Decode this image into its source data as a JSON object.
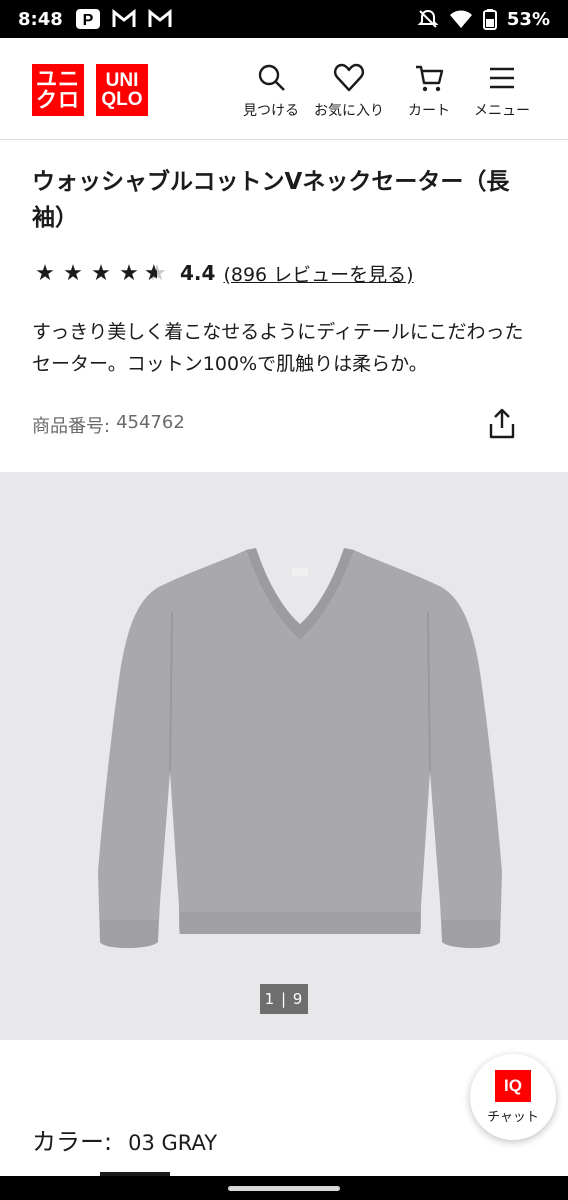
{
  "status_bar": {
    "time": "8:48",
    "battery": "53%",
    "icons": [
      "p-app-icon",
      "gmail-icon",
      "gmail-icon",
      "mute-icon",
      "wifi-icon",
      "battery-icon"
    ]
  },
  "header": {
    "logo_katakana_line1": "ユニ",
    "logo_katakana_line2": "クロ",
    "logo_latin_line1": "UNI",
    "logo_latin_line2": "QLO",
    "brand_color": "#ff0000",
    "nav": [
      {
        "label": "見つける",
        "icon": "search-icon"
      },
      {
        "label": "お気に入り",
        "icon": "heart-icon"
      },
      {
        "label": "カート",
        "icon": "cart-icon"
      },
      {
        "label": "メニュー",
        "icon": "menu-icon"
      }
    ]
  },
  "product": {
    "title": "ウォッシャブルコットンVネックセーター（長袖）",
    "rating": {
      "stars": 4.4,
      "value_label": "4.4",
      "review_link": "(896 レビューを見る)"
    },
    "description": "すっきり美しく着こなせるようにディテールにこだわったセーター。コットン100%で肌触りは柔らか。",
    "number_label": "商品番号:",
    "number_value": "454762"
  },
  "gallery": {
    "counter": "1 | 9",
    "background": "#e8e8ea",
    "garment_color": "#a9a9ab"
  },
  "color": {
    "label": "カラー:",
    "value": "03 GRAY"
  },
  "chat": {
    "badge": "IQ",
    "label": "チャット"
  }
}
